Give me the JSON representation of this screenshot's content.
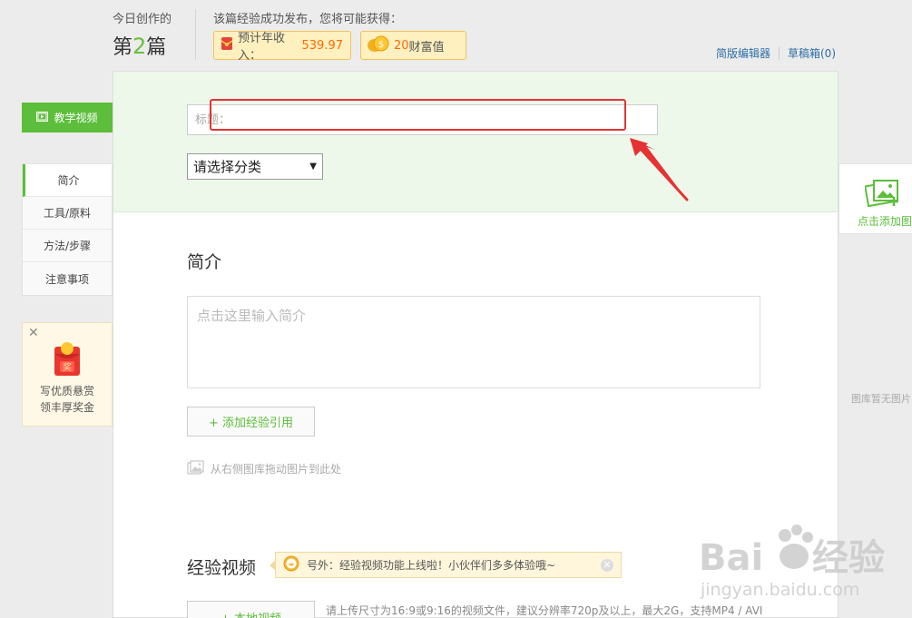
{
  "header": {
    "today_label": "今日创作的",
    "today_prefix": "第",
    "today_num": "2",
    "today_suffix": "篇",
    "reward_label": "该篇经验成功发布，您将可能获得：",
    "income_label": "预计年收入：",
    "income_value": "539.97",
    "wealth_num": "20",
    "wealth_label": "财富值",
    "simple_editor": "简版编辑器",
    "drafts": "草稿箱(0)"
  },
  "left_nav": {
    "video_button": "教学视频",
    "items": [
      "简介",
      "工具/原料",
      "方法/步骤",
      "注意事项"
    ],
    "promo_line1": "写优质悬赏",
    "promo_line2": "领丰厚奖金"
  },
  "form": {
    "title_placeholder": "标题：",
    "category_selected": "请选择分类",
    "intro_title": "简介",
    "intro_placeholder": "点击这里输入简介",
    "add_cite": "+ 添加经验引用",
    "drag_hint": "从右侧图库拖动图片到此处",
    "video_title": "经验视频",
    "notice_text": "号外：经验视频功能上线啦！小伙伴们多多体验哦~",
    "local_video": "+ 本地视频",
    "upload_hint": "请上传尺寸为16:9或9:16的视频文件，建议分辨率720p及以上，最大2G，支持MP4 / AVI"
  },
  "gallery": {
    "add_label": "点击添加图片",
    "empty_label": "图库暂无图片"
  },
  "colors": {
    "accent_green": "#5cbe3a",
    "annotation_red": "#e53333",
    "link_blue": "#2d6da3"
  }
}
